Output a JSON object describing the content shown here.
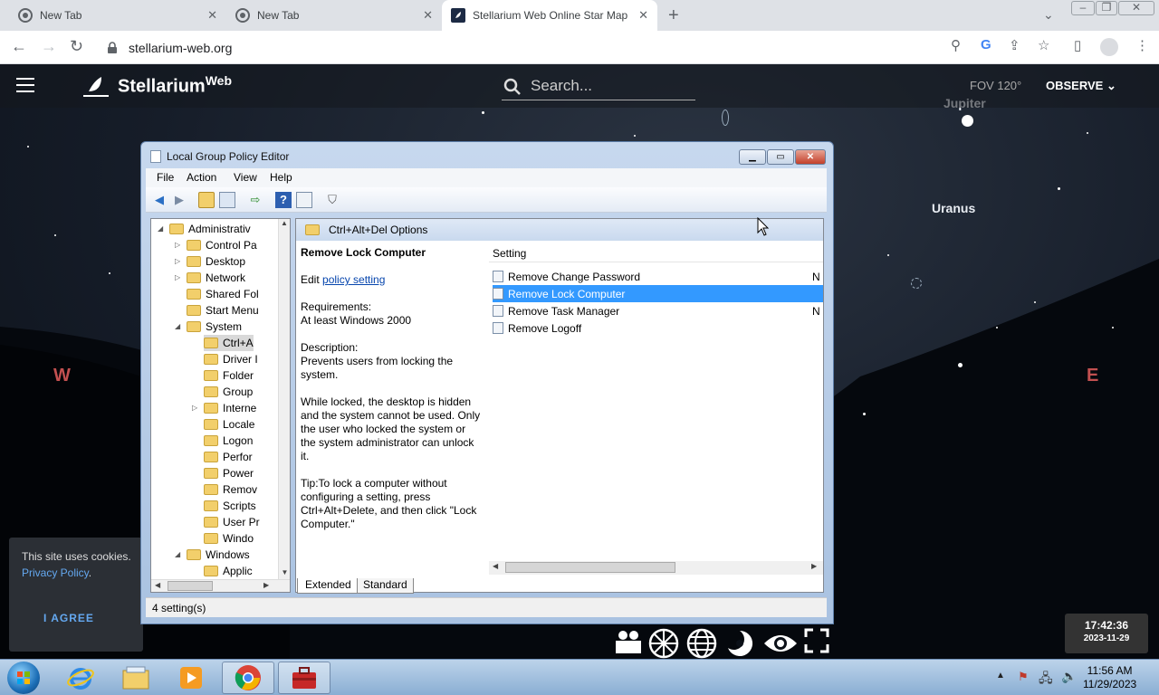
{
  "browser": {
    "tabs": [
      {
        "title": "New Tab",
        "active": false
      },
      {
        "title": "New Tab",
        "active": false
      },
      {
        "title": "Stellarium Web Online Star Map",
        "active": true
      }
    ],
    "url": "stellarium-web.org"
  },
  "stellarium": {
    "logo_text": "Stellarium",
    "logo_sup": "Web",
    "search_placeholder": "Search...",
    "fov": "FOV 120°",
    "observe": "OBSERVE",
    "planets": [
      "Jupiter",
      "Uranus"
    ],
    "cardinals": {
      "west": "W",
      "east": "E"
    },
    "cookie": {
      "text": "This site uses cookies.",
      "link": "Privacy Policy",
      "link_suffix": ".",
      "button": "I AGREE"
    },
    "time": "17:42:36",
    "date": "2023-11-29"
  },
  "gpe": {
    "title": "Local Group Policy Editor",
    "menu": [
      "File",
      "Action",
      "View",
      "Help"
    ],
    "tree": [
      {
        "label": "Administrativ",
        "indent": 0,
        "expander": "open"
      },
      {
        "label": "Control Pa",
        "indent": 1,
        "expander": "closed"
      },
      {
        "label": "Desktop",
        "indent": 1,
        "expander": "closed"
      },
      {
        "label": "Network",
        "indent": 1,
        "expander": "closed"
      },
      {
        "label": "Shared Fol",
        "indent": 1,
        "expander": "none"
      },
      {
        "label": "Start Menu",
        "indent": 1,
        "expander": "none"
      },
      {
        "label": "System",
        "indent": 1,
        "expander": "open"
      },
      {
        "label": "Ctrl+A",
        "indent": 2,
        "expander": "none",
        "selected": true
      },
      {
        "label": "Driver I",
        "indent": 2,
        "expander": "none"
      },
      {
        "label": "Folder",
        "indent": 2,
        "expander": "none"
      },
      {
        "label": "Group",
        "indent": 2,
        "expander": "none"
      },
      {
        "label": "Interne",
        "indent": 2,
        "expander": "closed"
      },
      {
        "label": "Locale",
        "indent": 2,
        "expander": "none"
      },
      {
        "label": "Logon",
        "indent": 2,
        "expander": "none"
      },
      {
        "label": "Perfor",
        "indent": 2,
        "expander": "none"
      },
      {
        "label": "Power",
        "indent": 2,
        "expander": "none"
      },
      {
        "label": "Remov",
        "indent": 2,
        "expander": "none"
      },
      {
        "label": "Scripts",
        "indent": 2,
        "expander": "none"
      },
      {
        "label": "User Pr",
        "indent": 2,
        "expander": "none"
      },
      {
        "label": "Windo",
        "indent": 2,
        "expander": "none"
      },
      {
        "label": "Windows",
        "indent": 1,
        "expander": "open"
      },
      {
        "label": "Applic",
        "indent": 2,
        "expander": "none"
      }
    ],
    "header": "Ctrl+Alt+Del Options",
    "description": {
      "title": "Remove Lock Computer",
      "edit_prefix": "Edit ",
      "edit_link": "policy setting",
      "req_label": "Requirements:",
      "req_value": "At least Windows 2000",
      "desc_label": "Description:",
      "desc_value": "Prevents users from locking the system.",
      "desc_more": "While locked, the desktop is hidden and the system cannot be used. Only the user who locked the system or the system administrator can unlock it.",
      "tip": "Tip:To lock a computer without configuring a setting, press Ctrl+Alt+Delete, and then click \"Lock Computer.\""
    },
    "setting_header": "Setting",
    "settings": [
      {
        "name": "Remove Change Password",
        "state": "N"
      },
      {
        "name": "Remove Lock Computer",
        "state": "",
        "selected": true
      },
      {
        "name": "Remove Task Manager",
        "state": "N"
      },
      {
        "name": "Remove Logoff",
        "state": ""
      }
    ],
    "tabs": [
      "Extended",
      "Standard"
    ],
    "status": "4 setting(s)"
  },
  "taskbar": {
    "clock_time": "11:56 AM",
    "clock_date": "11/29/2023"
  }
}
